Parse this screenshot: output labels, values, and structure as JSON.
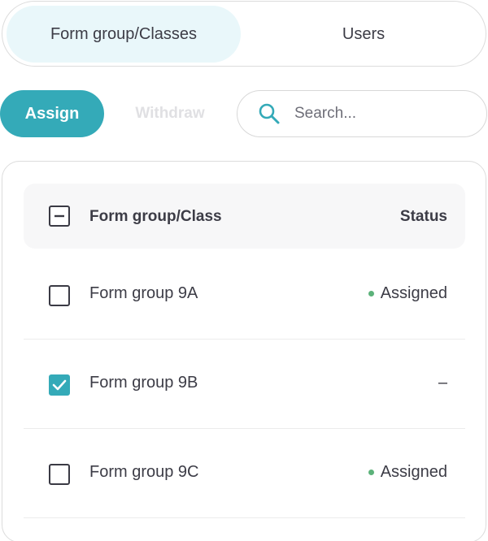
{
  "tabs": [
    {
      "label": "Form group/Classes",
      "active": true
    },
    {
      "label": "Users",
      "active": false
    }
  ],
  "actions": {
    "assign_label": "Assign",
    "withdraw_label": "Withdraw"
  },
  "search": {
    "icon": "search-icon",
    "placeholder": "Search...",
    "value": ""
  },
  "table": {
    "header": {
      "select_all_state": "indeterminate",
      "col_name": "Form group/Class",
      "col_status": "Status"
    },
    "rows": [
      {
        "name": "Form group 9A",
        "status": "Assigned",
        "checked": false
      },
      {
        "name": "Form group 9B",
        "status": "–",
        "checked": true
      },
      {
        "name": "Form group 9C",
        "status": "Assigned",
        "checked": false
      }
    ]
  },
  "colors": {
    "accent": "#34aab8",
    "active_tab_bg": "#e9f7fa",
    "status_dot": "#5cb27a",
    "disabled_text": "#e0e0e3"
  }
}
